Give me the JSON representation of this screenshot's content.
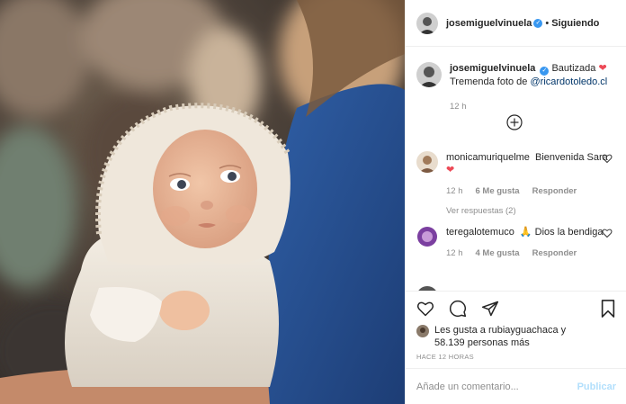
{
  "header": {
    "username": "josemiguelvinuela",
    "separator": "•",
    "follow_label": "Siguiendo"
  },
  "caption": {
    "username": "josemiguelvinuela",
    "text_1": "Bautizada",
    "text_2": "Tremenda foto de",
    "mention": "@ricardotoledo.cl",
    "time": "12 h"
  },
  "comments": [
    {
      "username": "monicamuriquelme",
      "text": "Bienvenida Sara",
      "time": "12 h",
      "likes": "6 Me gusta",
      "reply_label": "Responder",
      "view_replies": "Ver respuestas (2)"
    },
    {
      "username": "teregalotemuco",
      "text": "Dios la bendiga",
      "time": "12 h",
      "likes": "4 Me gusta",
      "reply_label": "Responder"
    }
  ],
  "likes": {
    "line_1": "Les gusta a",
    "user": "rubiayguachaca",
    "connector": "y",
    "line_2": "58.139 personas más"
  },
  "time_ago": "HACE 12 HORAS",
  "add_comment": {
    "placeholder": "Añade un comentario...",
    "publish_label": "Publicar"
  },
  "icons": {
    "heart": "heart-icon",
    "comment": "comment-icon",
    "share": "share-icon",
    "bookmark": "bookmark-icon",
    "plus": "plus-circle-icon",
    "verified": "verified-icon"
  },
  "colors": {
    "link": "#003569",
    "heart": "#ed4956",
    "muted": "#8e8e8e",
    "verified": "#3897f0",
    "publish": "#b2dffc"
  }
}
